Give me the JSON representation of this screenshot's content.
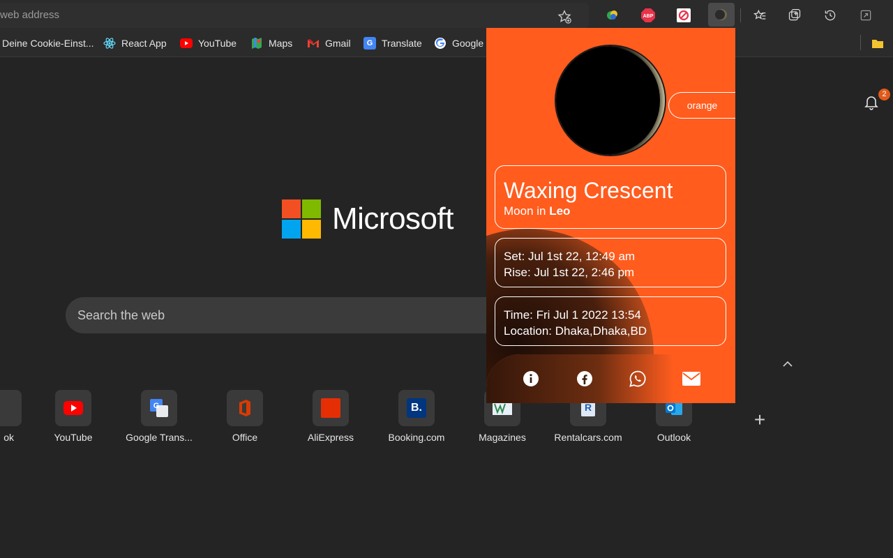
{
  "browser": {
    "address_placeholder": "web address",
    "bookmarks": [
      {
        "label": "Deine Cookie-Einst...",
        "icon": "globe-icon"
      },
      {
        "label": "React App",
        "icon": "react-icon"
      },
      {
        "label": "YouTube",
        "icon": "youtube-icon"
      },
      {
        "label": "Maps",
        "icon": "maps-icon"
      },
      {
        "label": "Gmail",
        "icon": "gmail-icon"
      },
      {
        "label": "Translate",
        "icon": "translate-icon"
      },
      {
        "label": "Google",
        "icon": "google-icon"
      }
    ],
    "extensions": [
      {
        "name": "color-picker-extension",
        "label": ""
      },
      {
        "name": "adblock-plus-extension",
        "label": "ABP"
      },
      {
        "name": "blocker-extension",
        "label": ""
      },
      {
        "name": "moon-phase-extension",
        "label": ""
      }
    ]
  },
  "newtab": {
    "logo_text": "Microsoft",
    "search_placeholder": "Search the web",
    "notification_count": "2",
    "tiles": [
      {
        "label": "ok",
        "icon": "facebook-icon"
      },
      {
        "label": "YouTube",
        "icon": "youtube-icon"
      },
      {
        "label": "Google Trans...",
        "icon": "translate-icon"
      },
      {
        "label": "Office",
        "icon": "office-icon"
      },
      {
        "label": "AliExpress",
        "icon": "aliexpress-icon"
      },
      {
        "label": "Booking.com",
        "icon": "booking-icon"
      },
      {
        "label": "Magazines",
        "icon": "magazines-icon"
      },
      {
        "label": "Rentalcars.com",
        "icon": "rentalcars-icon"
      },
      {
        "label": "Outlook",
        "icon": "outlook-icon"
      }
    ]
  },
  "popup": {
    "theme_button": "orange",
    "phase_name": "Waxing Crescent",
    "sign_prefix": "Moon in ",
    "sign_name": "Leo",
    "set_time": "Set: Jul 1st 22, 12:49 am",
    "rise_time": "Rise: Jul 1st 22, 2:46 pm",
    "current_time": "Time: Fri Jul 1 2022 13:54",
    "location": "Location: Dhaka,Dhaka,BD",
    "colors": {
      "background": "#ff5c1e",
      "border": "#ffffff"
    }
  }
}
